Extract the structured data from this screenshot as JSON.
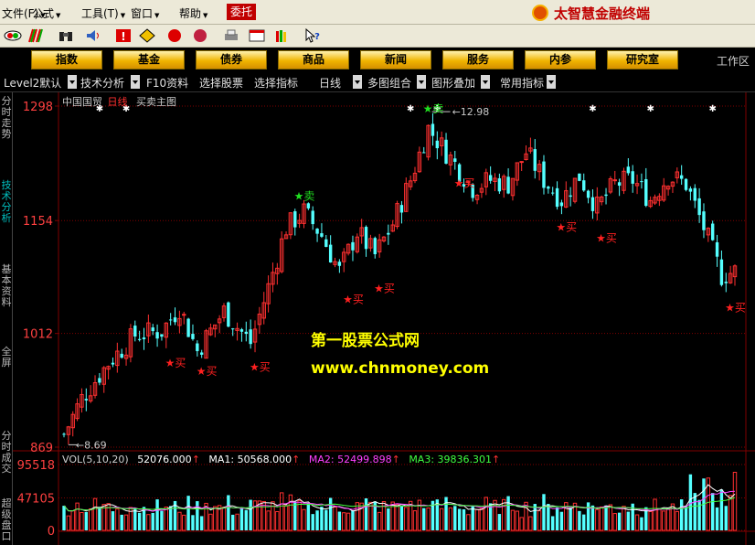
{
  "menubar": {
    "items": [
      {
        "label": "文件(F)"
      },
      {
        "label": "公式"
      },
      {
        "label": "工具(T)"
      },
      {
        "label": "窗口"
      },
      {
        "label": "帮助"
      }
    ],
    "entrust_label": "委托",
    "brand": "太智慧金融终端"
  },
  "sections": {
    "buttons": [
      {
        "label": "指数"
      },
      {
        "label": "基金"
      },
      {
        "label": "债券"
      },
      {
        "label": "商品"
      },
      {
        "label": "新闻"
      },
      {
        "label": "服务"
      },
      {
        "label": "内参"
      },
      {
        "label": "研究室"
      }
    ],
    "workzone": "工作区"
  },
  "toolrow": {
    "items": [
      {
        "label": "Level2默认"
      },
      {
        "label": "技术分析"
      },
      {
        "label": "F10资料"
      },
      {
        "label": "选择股票"
      },
      {
        "label": "选择指标"
      },
      {
        "label": "日线"
      },
      {
        "label": "多图组合"
      },
      {
        "label": "图形叠加"
      },
      {
        "label": "常用指标"
      }
    ]
  },
  "lefttabs": [
    {
      "label": "分时走势"
    },
    {
      "label": "技术分析"
    },
    {
      "label": "基本资料"
    },
    {
      "label": "全屏"
    },
    {
      "label": "分时成交"
    },
    {
      "label": "超级盘口"
    }
  ],
  "chart": {
    "stock_name": "中国国贸",
    "period": "日线",
    "indicator_name": "买卖主图",
    "buy_label": "买",
    "sell_label": "卖",
    "high_marker": "12.98",
    "low_marker": "8.69",
    "colors": {
      "up": "#ff3030",
      "down": "#54ffff",
      "buy_star": "#ff2020",
      "sell_star": "#20e020",
      "grid": "#800000",
      "axis_text": "#ff4040"
    }
  },
  "volume": {
    "header_name": "VOL(5,10,20)",
    "value": "52076.000",
    "ma1_label": "MA1:",
    "ma1_value": "50568.000",
    "ma2_label": "MA2:",
    "ma2_value": "52499.898",
    "ma3_label": "MA3:",
    "ma3_value": "39836.301",
    "colors": {
      "ma1": "#ffffff",
      "ma2": "#ff40ff",
      "ma3": "#40ff40"
    }
  },
  "watermark": {
    "line1": "第一股票公式网",
    "line2": "www.chnmoney.com"
  },
  "chart_data": {
    "type": "candlestick",
    "price_axis_labels": [
      "1298",
      "1154",
      "1012",
      "869"
    ],
    "ylim": [
      869,
      1298
    ],
    "volume_axis_labels": [
      "95518",
      "47105",
      "0"
    ],
    "vol_ylim": [
      0,
      95518
    ],
    "markers": [
      {
        "type": "buy",
        "x_index": 24,
        "price": 970
      },
      {
        "type": "buy",
        "x_index": 31,
        "price": 960
      },
      {
        "type": "buy",
        "x_index": 43,
        "price": 965
      },
      {
        "type": "sell",
        "x_index": 53,
        "price": 1180
      },
      {
        "type": "buy",
        "x_index": 64,
        "price": 1050
      },
      {
        "type": "buy",
        "x_index": 71,
        "price": 1064
      },
      {
        "type": "sell",
        "x_index": 82,
        "price": 1290
      },
      {
        "type": "buy",
        "x_index": 89,
        "price": 1196
      },
      {
        "type": "buy",
        "x_index": 112,
        "price": 1141
      },
      {
        "type": "buy",
        "x_index": 121,
        "price": 1127
      },
      {
        "type": "buy",
        "x_index": 150,
        "price": 1040
      }
    ]
  }
}
